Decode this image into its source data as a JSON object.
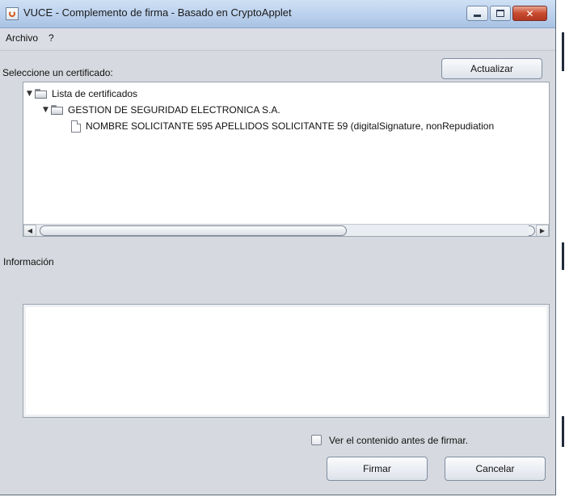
{
  "window": {
    "title": "VUCE - Complemento de firma - Basado en CryptoApplet",
    "icon": "java-cup-icon"
  },
  "caption_buttons": {
    "close_symbol": "✕"
  },
  "menu": {
    "items": [
      "Archivo",
      "?"
    ]
  },
  "certificate_section": {
    "label": "Seleccione un certificado:",
    "refresh_button": "Actualizar"
  },
  "tree": {
    "root": "Lista de certificados",
    "issuer": "GESTION DE SEGURIDAD ELECTRONICA S.A.",
    "certificate": "NOMBRE SOLICITANTE 595 APELLIDOS SOLICITANTE 59 (digitalSignature, nonRepudiation"
  },
  "information": {
    "label": "Información",
    "content": ""
  },
  "options": {
    "view_before_sign_label": "Ver el contenido antes de firmar.",
    "view_before_sign_checked": false
  },
  "actions": {
    "sign_button": "Firmar",
    "cancel_button": "Cancelar"
  },
  "colors": {
    "window_bg": "#d6d9df",
    "titlebar_blue": "#bcd2ee",
    "close_red": "#c84a2f"
  }
}
